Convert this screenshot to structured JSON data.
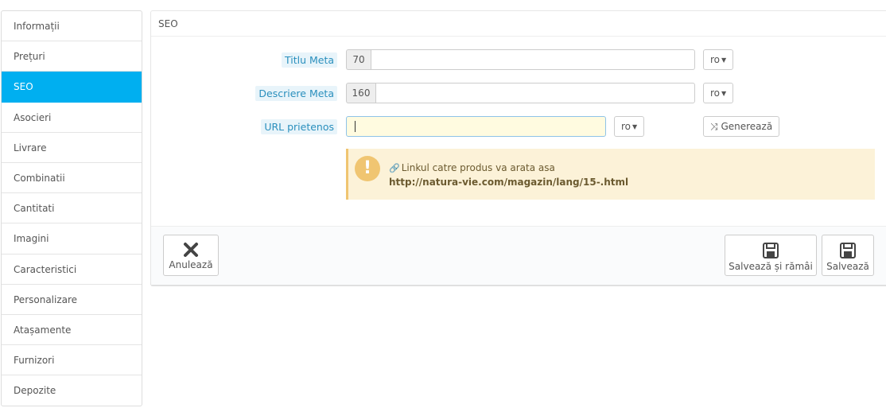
{
  "sidebar": {
    "items": [
      {
        "label": "Informații"
      },
      {
        "label": "Prețuri"
      },
      {
        "label": "SEO"
      },
      {
        "label": "Asocieri"
      },
      {
        "label": "Livrare"
      },
      {
        "label": "Combinatii"
      },
      {
        "label": "Cantitati"
      },
      {
        "label": "Imagini"
      },
      {
        "label": "Caracteristici"
      },
      {
        "label": "Personalizare"
      },
      {
        "label": "Atașamente"
      },
      {
        "label": "Furnizori"
      },
      {
        "label": "Depozite"
      }
    ],
    "active_index": 2
  },
  "panel": {
    "heading": "SEO",
    "meta_title": {
      "label": "Titlu Meta",
      "counter": "70",
      "value": "",
      "lang": "ro"
    },
    "meta_description": {
      "label": "Descriere Meta",
      "counter": "160",
      "value": "",
      "lang": "ro"
    },
    "friendly_url": {
      "label": "URL prietenos",
      "value": "",
      "lang": "ro",
      "generate_label": "Generează"
    },
    "alert": {
      "line1": "Linkul catre produs va arata asa",
      "line2": "http://natura-vie.com/magazin/lang/15-.html"
    }
  },
  "footer": {
    "cancel_label": "Anulează",
    "save_stay_label": "Salvează și rămâi",
    "save_label": "Salvează"
  },
  "colors": {
    "active": "#00aff0",
    "label_text": "#2a8fbd",
    "alert_bg": "#fcf2d8",
    "alert_accent": "#f0c571"
  }
}
